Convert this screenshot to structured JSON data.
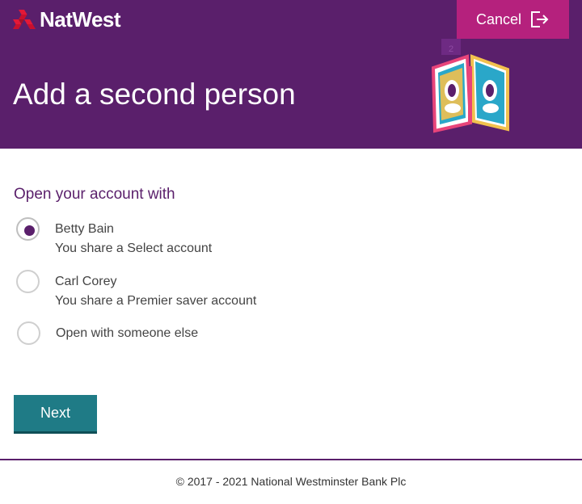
{
  "brand": {
    "name": "NatWest"
  },
  "header": {
    "cancel_label": "Cancel",
    "step_badge": "2",
    "title": "Add a second person"
  },
  "form": {
    "question": "Open your account with",
    "options": [
      {
        "label": "Betty Bain",
        "sub": "You share a Select account",
        "selected": true
      },
      {
        "label": "Carl Corey",
        "sub": "You share a Premier saver account",
        "selected": false
      },
      {
        "label": "Open with someone else",
        "sub": "",
        "selected": false
      }
    ],
    "next_label": "Next"
  },
  "footer": {
    "copyright": "© 2017 - 2021 National Westminster Bank Plc"
  },
  "colors": {
    "header_bg": "#5a1f6b",
    "cancel_bg": "#b5217d",
    "brand_red": "#e31837",
    "next_bg": "#1f7b86",
    "question_text": "#5a1f6b"
  },
  "icons": {
    "logo": "natwest-cubes-icon",
    "cancel": "exit-icon",
    "illustration": "people-doors-icon"
  }
}
